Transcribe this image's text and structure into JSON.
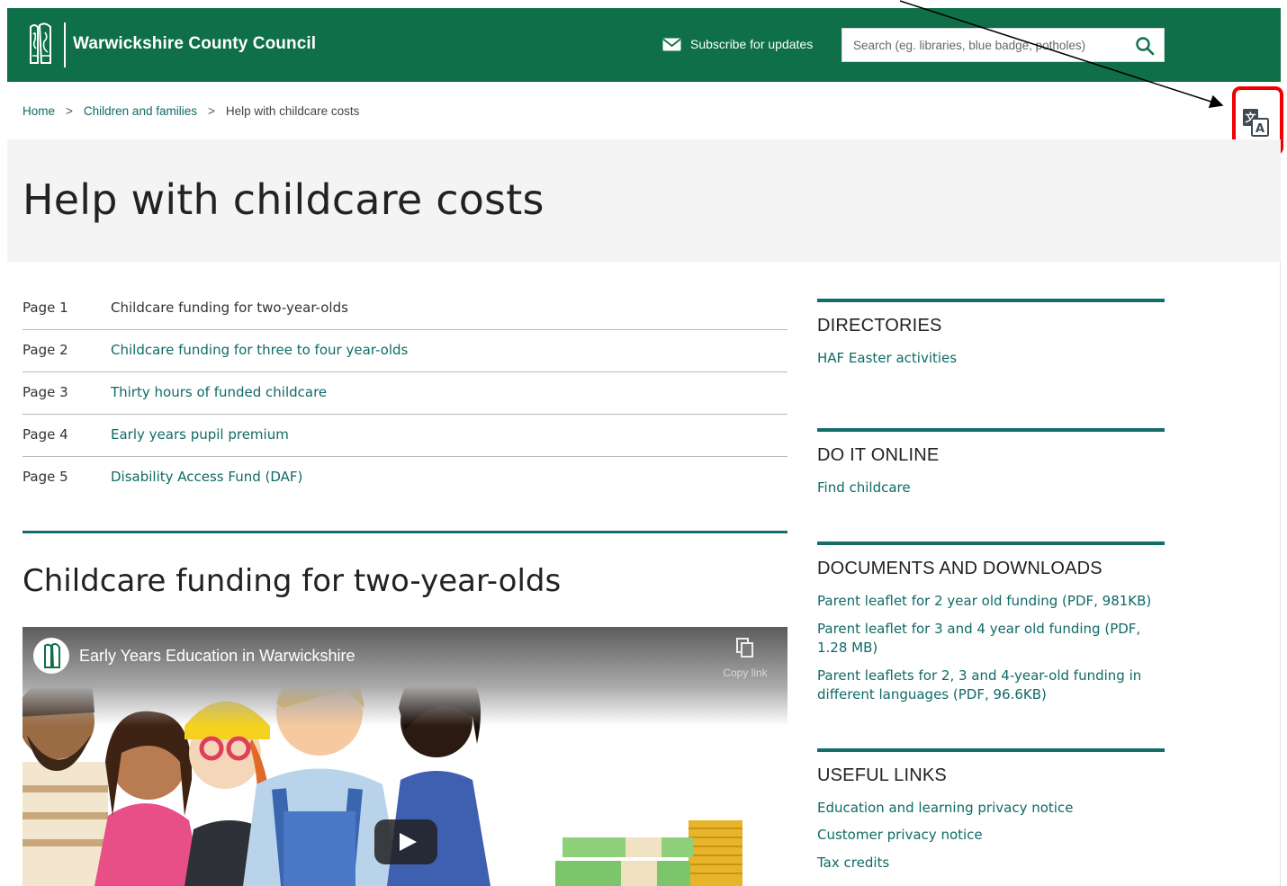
{
  "header": {
    "site_title": "Warwickshire County Council",
    "subscribe_label": "Subscribe for updates",
    "search_placeholder": "Search (eg. libraries, blue badge, potholes)",
    "bg_color": "#0e6f48"
  },
  "breadcrumb": {
    "items": [
      "Home",
      "Children and families"
    ],
    "current": "Help with childcare costs",
    "separator": ">"
  },
  "translate": {
    "icon": "translate-icon",
    "highlight_color": "#f00000"
  },
  "page": {
    "title": "Help with childcare costs"
  },
  "pages": [
    {
      "num": "Page 1",
      "label": "Childcare funding for two-year-olds",
      "active": true
    },
    {
      "num": "Page 2",
      "label": "Childcare funding for three to four year-olds",
      "active": false
    },
    {
      "num": "Page 3",
      "label": "Thirty hours of funded childcare",
      "active": false
    },
    {
      "num": "Page 4",
      "label": "Early years pupil premium",
      "active": false
    },
    {
      "num": "Page 5",
      "label": "Disability Access Fund (DAF)",
      "active": false
    }
  ],
  "section": {
    "title": "Childcare funding for two-year-olds"
  },
  "video": {
    "title": "Early Years Education in Warwickshire",
    "copy_label": "Copy link"
  },
  "sidebar": {
    "directories": {
      "heading": "DIRECTORIES",
      "links": [
        "HAF Easter activities"
      ]
    },
    "do_it_online": {
      "heading": "DO IT ONLINE",
      "links": [
        "Find childcare"
      ]
    },
    "documents": {
      "heading": "DOCUMENTS AND DOWNLOADS",
      "links": [
        "Parent leaflet for 2 year old funding (PDF, 981KB)",
        "Parent leaflet for 3 and 4 year old funding (PDF, 1.28 MB)",
        "Parent leaflets for 2, 3 and 4-year-old funding in different languages (PDF, 96.6KB)"
      ]
    },
    "useful_links": {
      "heading": "USEFUL LINKS",
      "links": [
        "Education and learning privacy notice",
        "Customer privacy notice",
        "Tax credits"
      ]
    }
  },
  "colors": {
    "accent": "#146c6c",
    "link": "#0f6a66"
  }
}
